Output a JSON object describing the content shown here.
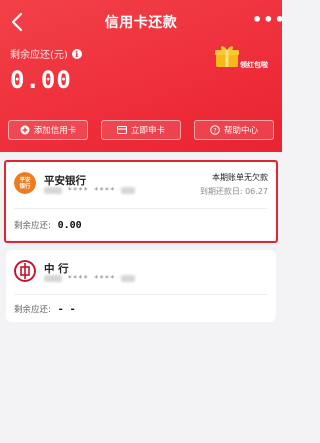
{
  "nav": {
    "title": "信用卡还款",
    "more_label": "•••"
  },
  "summary": {
    "remaining_label": "剩余应还(元)",
    "amount": "0.00",
    "gift_label": "领红包啦"
  },
  "actions": [
    {
      "label": "添加信用卡",
      "icon": "plus-circle-icon"
    },
    {
      "label": "立即申卡",
      "icon": "card-icon"
    },
    {
      "label": "帮助中心",
      "icon": "help-icon"
    }
  ],
  "cards": [
    {
      "bank_name": "平安银行",
      "logo_text": "平安\n银行",
      "card_number": "**** ****",
      "status": "本期账单无欠款",
      "due_label": "到期还款日:",
      "due_date": "06.27",
      "remain_label": "剩余应还:",
      "remain_value": "0.00"
    },
    {
      "bank_name": "中  行",
      "card_number": "**** ****",
      "remain_label": "剩余应还:",
      "remain_value": "- -"
    }
  ],
  "colors": {
    "brand_red": "#ee2e3a",
    "highlight_outline": "#e0262f",
    "gift_gold": "#f6b91b"
  }
}
